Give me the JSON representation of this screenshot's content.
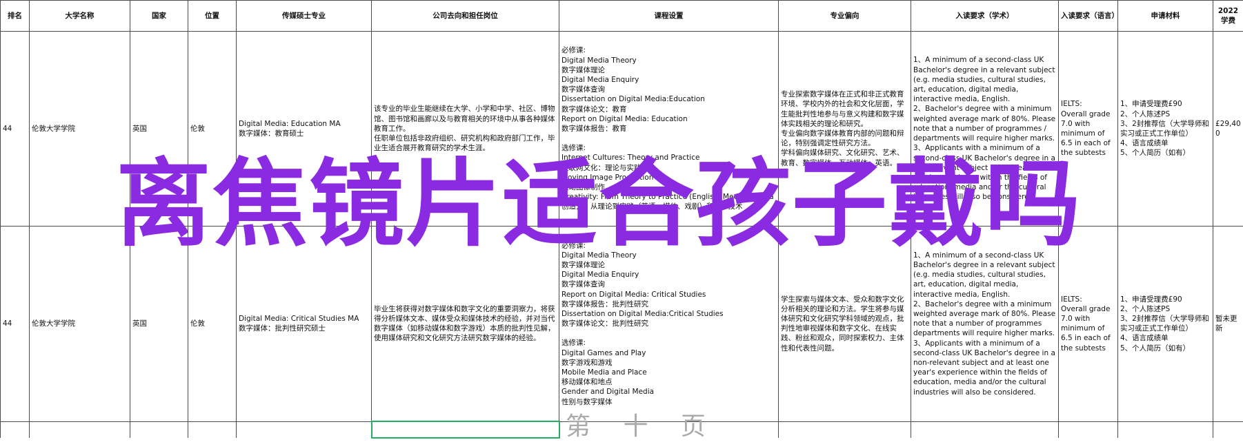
{
  "headers": [
    "排名",
    "大学名称",
    "国家",
    "位置",
    "传媒硕士专业",
    "公司去向和担任岗位",
    "课程设置",
    "专业偏向",
    "入读要求（学术）",
    "入读要求（语言）",
    "申请材料",
    "2022学费"
  ],
  "rows": [
    {
      "rank": "44",
      "university": "伦敦大学学院",
      "country": "英国",
      "location": "伦敦",
      "program": [
        "Digital Media: Education MA",
        "数字媒体：教育硕士"
      ],
      "career": "该专业的毕业生能继续在大学、小学和中学、社区、博物馆、图书馆和画廊以及与教育相关的环境中从事各种媒体教育工作。\n任职单位包括非政府组织、研究机构和政府部门工作，毕业生适合展开教育研究的学术生涯。",
      "courses": [
        "必修课:",
        "Digital Media Theory",
        "数字媒体理论",
        "Digital Media Enquiry",
        "数字媒体查询",
        "Dissertation on Digital Media:Education",
        "数字媒体论文：教育",
        "Report on Digital Media: Education",
        "数字媒体报告：教育",
        "",
        "选修课:",
        "Internet Cultures: Theory and Practice",
        "互联网文化：理论与实践",
        "Moving Image Production",
        "运动图像制作",
        "Creativity: From Theory to Practice (English, Media, Drama",
        "创造力：从理论到实践（英语、媒体、戏剧）和数字技术"
      ],
      "focus": "专业探索数字媒体在正式和非正式教育环境、学校内外的社会和文化层面，学生能批判性地参与与意义构建和数字媒体实践相关的理论和研究。\n专业偏向数字媒体教育内部的问题和辩论，特别强调定性研究方法。\n学科偏向媒体研究、文化研究、艺术、教育、数字媒体、互动媒体、英语。",
      "academic": [
        "1、A minimum of a second-class UK Bachelor's degree in a relevant subject (e.g. media studies, cultural studies, art, education, digital media, interactive media, English.",
        "2、Bachelor's degree with a minimum weighted average mark of 80%. Please note that a number of programmes / departments will require higher marks.",
        "3、Applicants with a minimum of a second-class UK Bachelor's degree in a non-relevant subject and at least one year's experience within the fields of education, media and/or the cultural industries will also be considered."
      ],
      "language": "IELTS:\nOverall grade 7.0 with minimum of 6.5 in each of the subtests",
      "materials": [
        "1、申请受理费£90",
        "2、个人陈述PS",
        "3、2封推荐信（大学导师和实习或正式工作单位）",
        "4、语言成绩单",
        "5、个人简历（如有）"
      ],
      "tuition": "£29,400"
    },
    {
      "rank": "44",
      "university": "伦敦大学学院",
      "country": "英国",
      "location": "伦敦",
      "program": [
        "Digital Media: Critical Studies MA",
        "数字媒体：批判性研究硕士"
      ],
      "career": "毕业生将获得对数字媒体和数字文化的重要洞察力，将获得分析媒体文本、媒体受众和媒体技术的经验，并对当代数字媒体（如移动媒体和数字游戏）本质的批判性见解，使用媒体研究和文化研究方法研究数字媒体的经验。",
      "courses": [
        "必修课:",
        "Digital Media Theory",
        "数字媒体理论",
        "Digital Media Enquiry",
        "数字媒体查询",
        "Report on Digital Media: Critical Studies",
        "数字媒体报告：批判性研究",
        "Dissertation on Digital Media:Critical Studies",
        "数字媒体论文：批判性研究",
        "",
        "选修课:",
        "Digital Games and Play",
        "数字游戏和游戏",
        "Mobile Media and Place",
        "移动媒体和地点",
        "Gender and Digital Media",
        "性别与数字媒体"
      ],
      "focus": "学生探索与媒体文本、受众和数字文化分析相关的理论和方法。学生将参与媒体研究和文化研究学科领域的观点，批判性地审视媒体和数字文化、在线实践、粉丝和观众，同时探索权力、主体性和代表性问题。",
      "academic": [
        "1、A minimum of a second-class UK Bachelor's degree in a relevant subject (e.g. media studies, cultural studies, art, education, digital media, interactive media, English.",
        "2、Bachelor's degree with a minimum weighted average mark of 80%. Please note that a number of programmes departments will require higher marks.",
        "3、Applicants with a minimum of a second-class UK Bachelor's degree in a non-relevant subject and at least one year's experience within the fields of education, media and/or the cultural industries will also be considered."
      ],
      "language": "IELTS:\nOverall grade 7.0 with minimum of 6.5 in each of the subtests",
      "materials": [
        "1、申请受理费£90",
        "2、个人陈述PS",
        "3、2封推荐信（大学导师和实习或正式工作单位）",
        "4、语言成绩单",
        "5、个人简历（如有）"
      ],
      "tuition": "暂未更新"
    }
  ],
  "overlay": {
    "watermark": "离焦镜片适合孩子戴吗",
    "watermark_color": "#8a2be2",
    "faint_text": "第 十 页"
  },
  "colors": {
    "grid": "#4a4a4a",
    "selection": "#27ae60"
  }
}
